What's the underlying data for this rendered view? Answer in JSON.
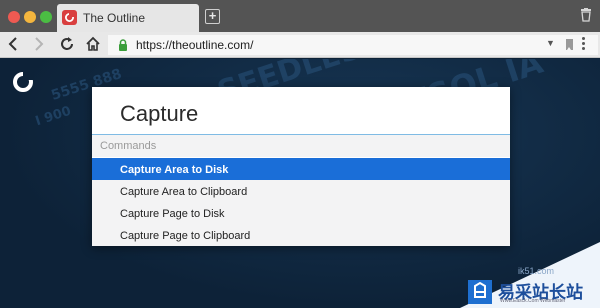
{
  "tab": {
    "title": "The Outline",
    "new_tab_label": "+"
  },
  "addressbar": {
    "url": "https://theoutline.com/",
    "dropdown": "▼"
  },
  "icons": {
    "back": "back-arrow-icon",
    "forward": "forward-arrow-icon",
    "reload": "reload-icon",
    "home": "home-icon",
    "lock": "lock-icon",
    "trash": "trash-icon"
  },
  "colors": {
    "selected_item": "#1a6ed8",
    "page_background": "#0d2238",
    "close": "#ee5a52",
    "minimize": "#f4b63e",
    "zoom": "#4bbd43",
    "lock": "#3a9d3a"
  },
  "page": {
    "decoration": [
      "5555 888",
      "SEEDLES",
      "ICTSOL IA",
      "I 900"
    ]
  },
  "palette": {
    "title": "Capture",
    "section_header": "Commands",
    "items": [
      {
        "label": "Capture Area to Disk",
        "selected": true
      },
      {
        "label": "Capture Area to Clipboard",
        "selected": false
      },
      {
        "label": "Capture Page to Disk",
        "selected": false
      },
      {
        "label": "Capture Page to Clipboard",
        "selected": false
      }
    ]
  },
  "watermark": {
    "title": "易采站长站",
    "subtitle": "Www.Easck.Com Webmaster",
    "url": "ik51.com"
  }
}
